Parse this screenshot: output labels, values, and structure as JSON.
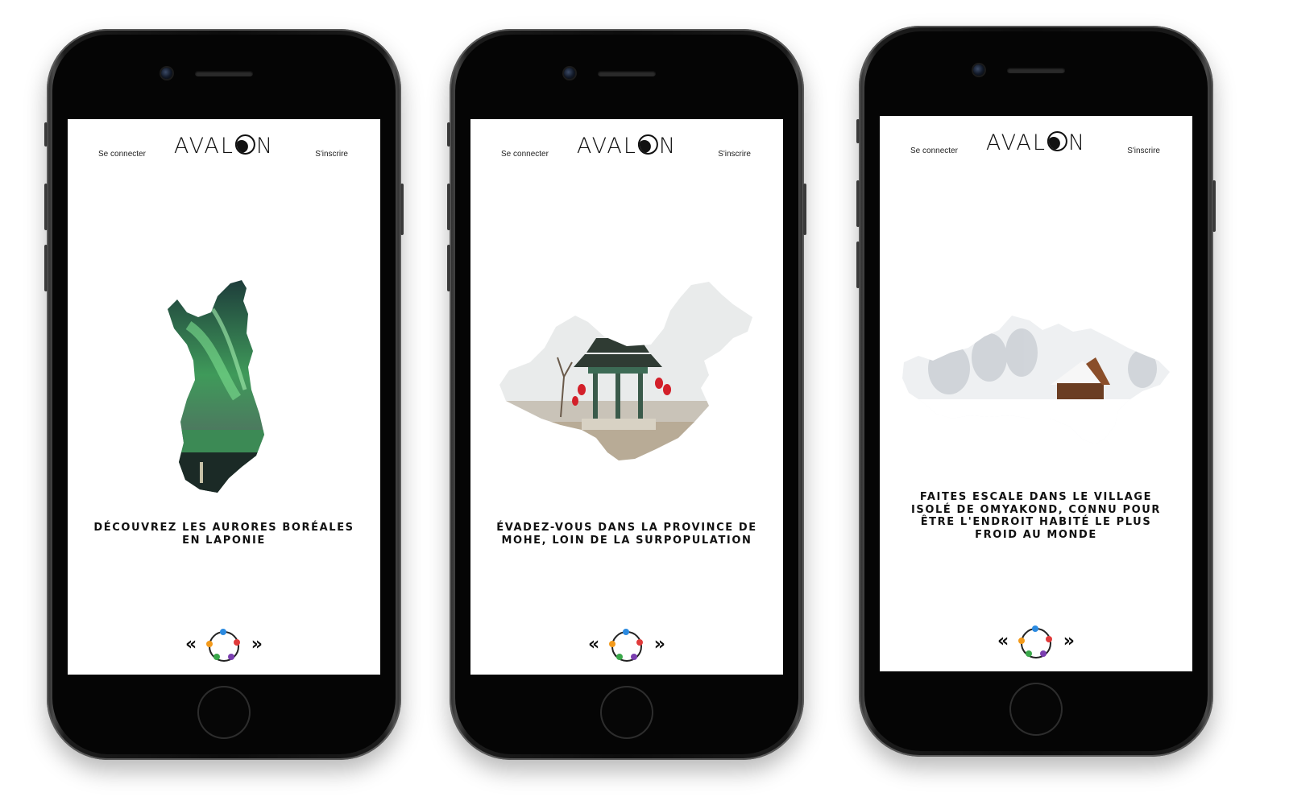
{
  "app": {
    "brand": "AVALON"
  },
  "nav": {
    "login": "Se connecter",
    "signup": "S'inscrire"
  },
  "colors": {
    "aurora_green": "#3f9a5a",
    "lantern_red": "#d3202a",
    "pager_dots": [
      "#2b8ae0",
      "#f39a1b",
      "#7b3fb0",
      "#3aa84a",
      "#e03a3a"
    ]
  },
  "screens": [
    {
      "id": "finland",
      "image": "finland-aurora-map",
      "caption": "DÉCOUVREZ LES AURORES BORÉALES EN LAPONIE"
    },
    {
      "id": "china",
      "image": "china-pagoda-map",
      "caption": "ÉVADEZ-VOUS DANS LA PROVINCE DE MOHE, LOIN DE LA SURPOPULATION"
    },
    {
      "id": "russia",
      "image": "russia-snow-cabin-map",
      "caption": "FAITES ESCALE DANS LE VILLAGE ISOLÉ DE OMYAKOND, CONNU POUR ÊTRE L'ENDROIT HABITÉ LE PLUS FROID AU MONDE"
    }
  ],
  "pager": {
    "prev_icon": "double-chevron-left-icon",
    "next_icon": "double-chevron-right-icon",
    "prev": "«",
    "next": "»"
  }
}
